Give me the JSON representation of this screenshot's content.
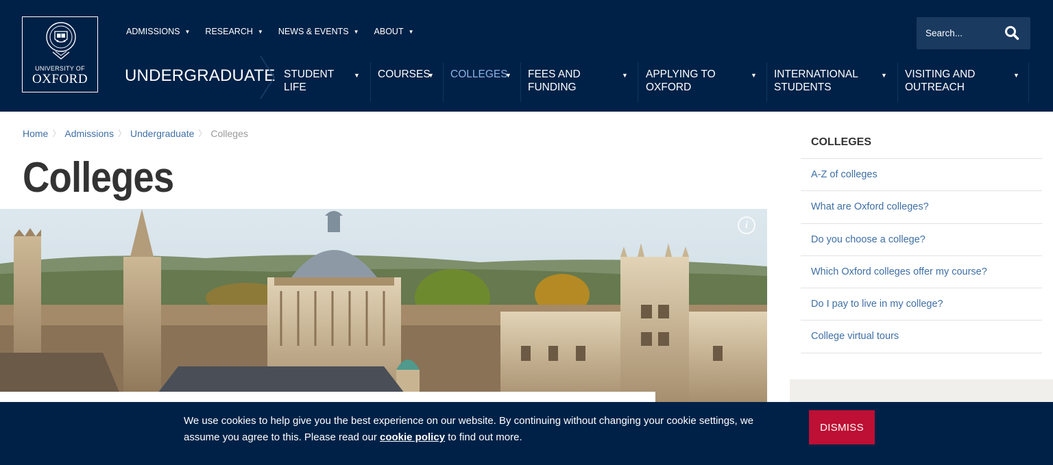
{
  "logo": {
    "line1": "UNIVERSITY OF",
    "line2": "OXFORD"
  },
  "top_nav": [
    {
      "label": "ADMISSIONS"
    },
    {
      "label": "RESEARCH"
    },
    {
      "label": "NEWS & EVENTS"
    },
    {
      "label": "ABOUT"
    }
  ],
  "search": {
    "placeholder": "Search..."
  },
  "section_title": "UNDERGRADUATE",
  "main_nav": [
    {
      "label_1": "STUDENT",
      "label_2": "LIFE"
    },
    {
      "label_1": "COURSES",
      "label_2": ""
    },
    {
      "label_1": "COLLEGES",
      "label_2": "",
      "active": true
    },
    {
      "label_1": "FEES AND",
      "label_2": "FUNDING"
    },
    {
      "label_1": "APPLYING TO",
      "label_2": "OXFORD"
    },
    {
      "label_1": "INTERNATIONAL",
      "label_2": "STUDENTS"
    },
    {
      "label_1": "VISITING AND",
      "label_2": "OUTREACH"
    }
  ],
  "breadcrumb": {
    "items": [
      "Home",
      "Admissions",
      "Undergraduate"
    ],
    "current": "Colleges"
  },
  "page_title": "Colleges",
  "hero": {
    "info_icon_label": "i"
  },
  "sidebar": {
    "heading": "COLLEGES",
    "links": [
      "A-Z of colleges",
      "What are Oxford colleges?",
      "Do you choose a college?",
      "Which Oxford colleges offer my course?",
      "Do I pay to live in my college?",
      "College virtual tours"
    ]
  },
  "cookie": {
    "message_before": "We use cookies to help give you the best experience on our website. By continuing without changing your cookie settings, we assume you agree to this. Please read our ",
    "link": "cookie policy",
    "message_after": " to find out more.",
    "dismiss": "DISMISS"
  },
  "colors": {
    "navy": "#002147",
    "link_blue": "#3f6fa6",
    "active_nav": "#8fb2e6",
    "dismiss_red": "#be0f34"
  }
}
